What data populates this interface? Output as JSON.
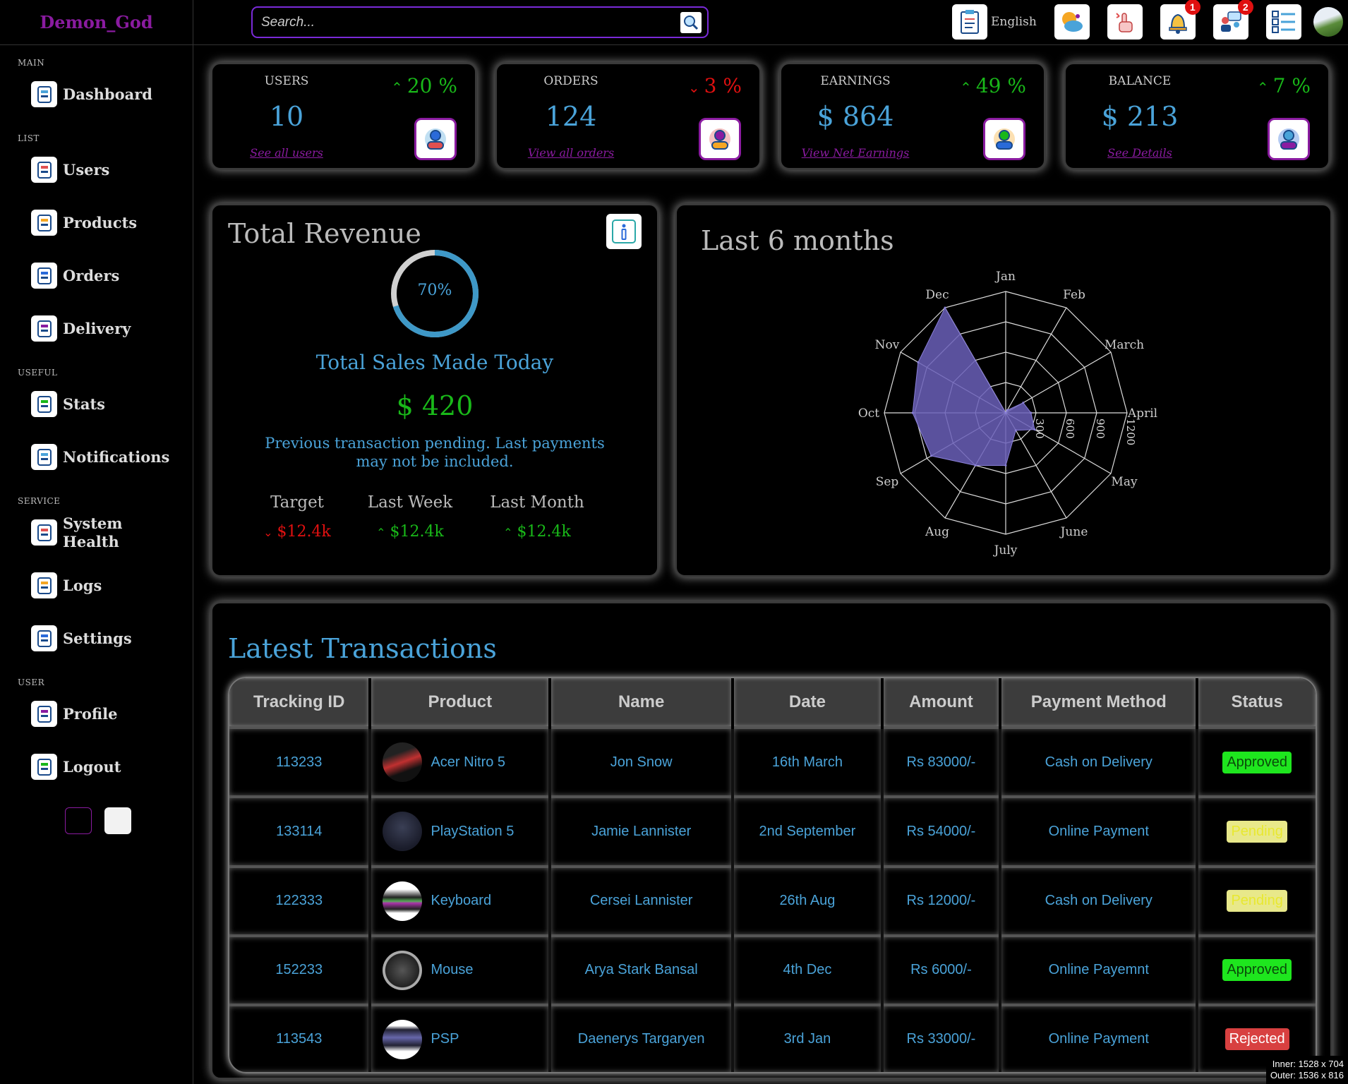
{
  "brand": "Demon_God",
  "search": {
    "placeholder": "Search..."
  },
  "topbar": {
    "language": "English",
    "icons": [
      "report-icon",
      "moon-icon",
      "pointer-icon",
      "bell-icon",
      "chat-icon",
      "list-icon"
    ],
    "notification_count": "1",
    "message_count": "2"
  },
  "sidebar": {
    "sections": [
      {
        "title": "MAIN",
        "items": [
          {
            "label": "Dashboard",
            "icon": "clipboard-icon"
          }
        ]
      },
      {
        "title": "LIST",
        "items": [
          {
            "label": "Users",
            "icon": "user-icon"
          },
          {
            "label": "Products",
            "icon": "store-icon"
          },
          {
            "label": "Orders",
            "icon": "phone-icon"
          },
          {
            "label": "Delivery",
            "icon": "truck-icon"
          }
        ]
      },
      {
        "title": "USEFUL",
        "items": [
          {
            "label": "Stats",
            "icon": "chart-icon"
          },
          {
            "label": "Notifications",
            "icon": "bell-icon"
          }
        ]
      },
      {
        "title": "SERVICE",
        "items": [
          {
            "label": "System Health",
            "icon": "lungs-icon"
          },
          {
            "label": "Logs",
            "icon": "log-icon"
          },
          {
            "label": "Settings",
            "icon": "gear-icon"
          }
        ]
      },
      {
        "title": "USER",
        "items": [
          {
            "label": "Profile",
            "icon": "profile-icon"
          },
          {
            "label": "Logout",
            "icon": "logout-icon"
          }
        ]
      }
    ]
  },
  "widgets": [
    {
      "title": "USERS",
      "pct": "20 %",
      "dir": "up",
      "value": "10",
      "link": "See all users",
      "icon": "user-check-icon"
    },
    {
      "title": "ORDERS",
      "pct": "3 %",
      "dir": "down",
      "value": "124",
      "link": "View all orders",
      "icon": "order-phone-icon"
    },
    {
      "title": "EARNINGS",
      "pct": "49 %",
      "dir": "up",
      "value": "$ 864",
      "link": "View Net Earnings",
      "icon": "money-hand-icon"
    },
    {
      "title": "BALANCE",
      "pct": "7 %",
      "dir": "up",
      "value": "$ 213",
      "link": "See Details",
      "icon": "wallet-icon"
    }
  ],
  "revenue": {
    "title": "Total Revenue",
    "progress_label": "70%",
    "progress": 0.7,
    "subtitle": "Total Sales Made Today",
    "amount": "$ 420",
    "note": "Previous transaction pending. Last payments may not be included.",
    "stats": [
      {
        "label": "Target",
        "value": "$12.4k",
        "dir": "down"
      },
      {
        "label": "Last Week",
        "value": "$12.4k",
        "dir": "up"
      },
      {
        "label": "Last Month",
        "value": "$12.4k",
        "dir": "up"
      }
    ]
  },
  "chart_data": {
    "type": "radar",
    "title": "Last 6 months",
    "categories": [
      "Jan",
      "Feb",
      "March",
      "April",
      "May",
      "June",
      "July",
      "Aug",
      "Sep",
      "Oct",
      "Nov",
      "Dec"
    ],
    "values": [
      0,
      30,
      200,
      250,
      330,
      200,
      520,
      600,
      850,
      920,
      1000,
      1200
    ],
    "radial_ticks": [
      "300",
      "600",
      "900",
      "1200"
    ],
    "rmax": 1200,
    "fill": "#6a5fb8"
  },
  "transactions": {
    "title": "Latest Transactions",
    "columns": [
      "Tracking ID",
      "Product",
      "Name",
      "Date",
      "Amount",
      "Payment Method",
      "Status"
    ],
    "rows": [
      {
        "id": "113233",
        "product": "Acer Nitro 5",
        "name": "Jon Snow",
        "date": "16th March",
        "amount": "Rs 83000/-",
        "method": "Cash on Delivery",
        "status": "Approved"
      },
      {
        "id": "133114",
        "product": "PlayStation 5",
        "name": "Jamie Lannister",
        "date": "2nd September",
        "amount": "Rs 54000/-",
        "method": "Online Payment",
        "status": "Pending"
      },
      {
        "id": "122333",
        "product": "Keyboard",
        "name": "Cersei Lannister",
        "date": "26th Aug",
        "amount": "Rs 12000/-",
        "method": "Cash on Delivery",
        "status": "Pending"
      },
      {
        "id": "152233",
        "product": "Mouse",
        "name": "Arya Stark Bansal",
        "date": "4th Dec",
        "amount": "Rs 6000/-",
        "method": "Online Payemnt",
        "status": "Approved"
      },
      {
        "id": "113543",
        "product": "PSP",
        "name": "Daenerys Targaryen",
        "date": "3rd Jan",
        "amount": "Rs 33000/-",
        "method": "Online Payment",
        "status": "Rejected"
      }
    ]
  },
  "status_colors": {
    "Approved": "#1ee61e",
    "Pending": "#e8e88a",
    "Rejected": "#d84040"
  },
  "viewport": {
    "inner": "Inner: 1528 x 704",
    "outer": "Outer: 1536 x 816"
  }
}
